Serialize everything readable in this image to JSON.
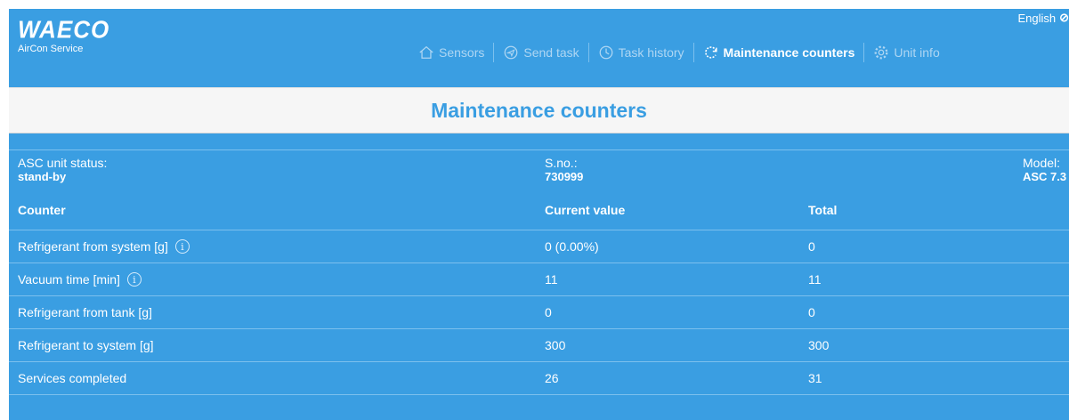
{
  "header": {
    "logo": "WAECO",
    "logo_sub": "AirCon Service",
    "language": "English",
    "nav": [
      {
        "label": "Sensors",
        "icon": "house-icon",
        "active": false
      },
      {
        "label": "Send task",
        "icon": "send-icon",
        "active": false
      },
      {
        "label": "Task history",
        "icon": "history-icon",
        "active": false
      },
      {
        "label": "Maintenance counters",
        "icon": "refresh-icon",
        "active": true
      },
      {
        "label": "Unit info",
        "icon": "gear-icon",
        "active": false
      }
    ]
  },
  "page_title": "Maintenance counters",
  "status": {
    "unit_label": "ASC unit status:",
    "unit_value": "stand-by",
    "sno_label": "S.no.:",
    "sno_value": "730999",
    "model_label": "Model:",
    "model_value": "ASC 7.3"
  },
  "table": {
    "headers": [
      "Counter",
      "Current value",
      "Total"
    ],
    "rows": [
      {
        "counter": "Refrigerant from system [g]",
        "current": "0 (0.00%)",
        "total": "0",
        "info": true
      },
      {
        "counter": "Vacuum time [min]",
        "current": "11",
        "total": "11",
        "info": true
      },
      {
        "counter": "Refrigerant from tank [g]",
        "current": "0",
        "total": "0",
        "info": false
      },
      {
        "counter": "Refrigerant to system [g]",
        "current": "300",
        "total": "300",
        "info": false
      },
      {
        "counter": "Services completed",
        "current": "26",
        "total": "31",
        "info": false
      }
    ]
  },
  "colors": {
    "background": "#3a9ee2",
    "title": "#3a9ee2",
    "title_box": "#f6f6f6",
    "nav_inactive": "#aed6f3"
  }
}
